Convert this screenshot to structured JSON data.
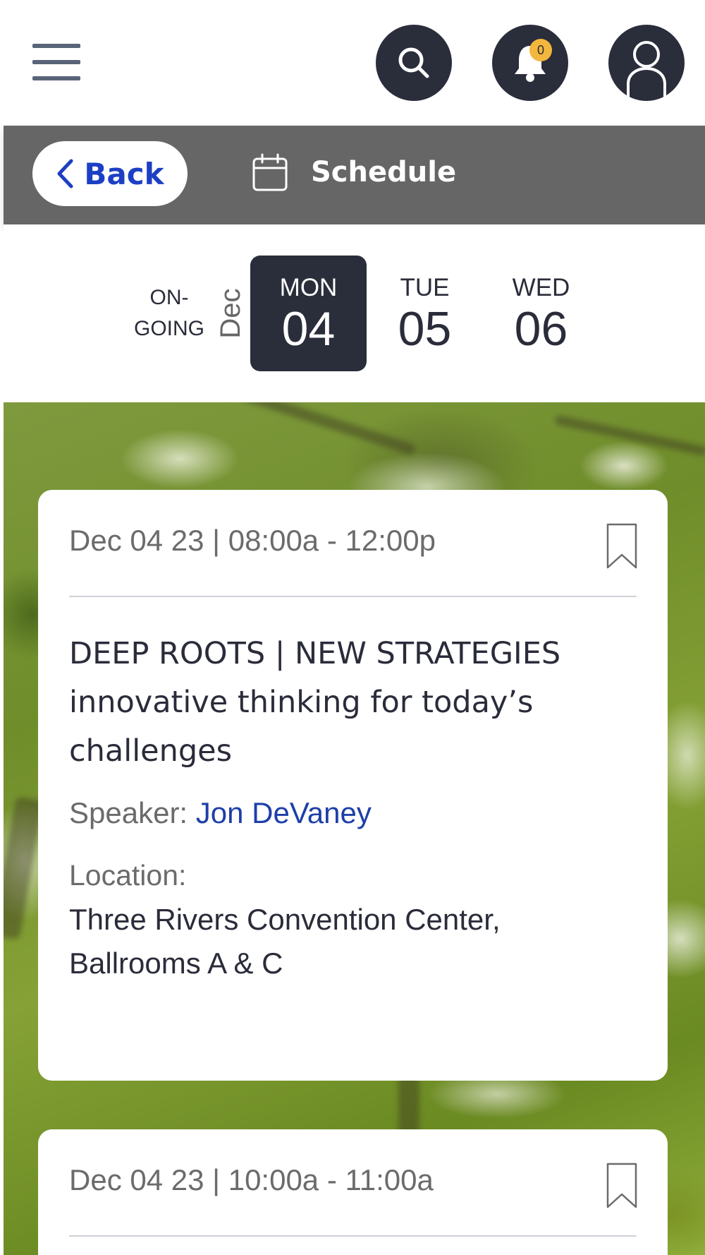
{
  "header": {
    "menu_icon": "hamburger-icon",
    "search_icon": "search-icon",
    "bell_icon": "bell-icon",
    "notification_count": "0",
    "user_icon": "user-icon"
  },
  "schedule_bar": {
    "back_label": "Back",
    "calendar_icon": "calendar-icon",
    "title": "Schedule"
  },
  "date_strip": {
    "ongoing_line1": "ON-",
    "ongoing_line2": "GOING",
    "month": "Dec",
    "days": [
      {
        "name": "MON",
        "num": "04",
        "selected": true
      },
      {
        "name": "TUE",
        "num": "05",
        "selected": false
      },
      {
        "name": "WED",
        "num": "06",
        "selected": false
      }
    ]
  },
  "sessions": [
    {
      "time": "Dec 04 23 | 08:00a - 12:00p",
      "title": "DEEP ROOTS | NEW STRATEGIES innovative thinking for today’s challenges",
      "speaker_label": "Speaker:",
      "speaker_name": "Jon DeVaney",
      "location_label": "Location:",
      "location": "Three Rivers Convention Center, Ballrooms A & C"
    },
    {
      "time": "Dec 04 23 | 10:00a - 11:00a"
    }
  ],
  "colors": {
    "dark": "#2a2d3a",
    "bar_gray": "#666666",
    "link_blue": "#1d3fa8",
    "badge_yellow": "#f3b73f"
  }
}
